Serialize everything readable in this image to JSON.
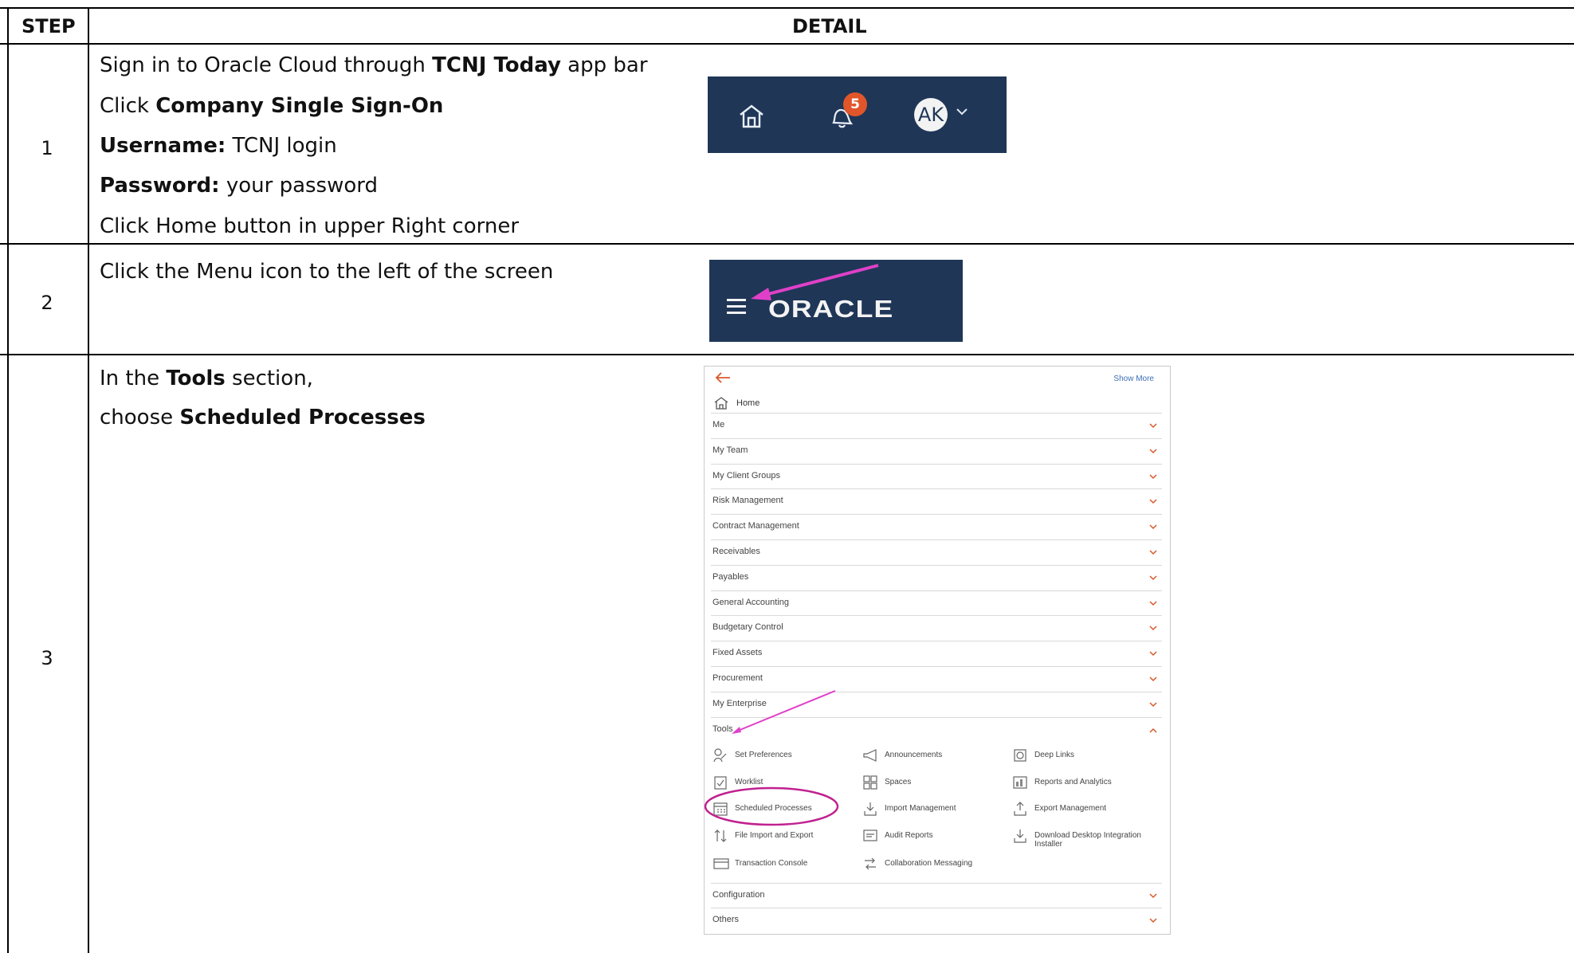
{
  "table": {
    "header_step": "STEP",
    "header_detail": "DETAIL"
  },
  "steps": [
    {
      "number": "1",
      "lines": [
        {
          "pre": "Sign in to Oracle Cloud through ",
          "bold": "TCNJ Today",
          "post": " app bar"
        },
        {
          "pre": "Click ",
          "bold": "Company Single Sign-On",
          "post": ""
        },
        {
          "pre": "",
          "bold": "Username:",
          "post": " TCNJ login"
        },
        {
          "pre": "",
          "bold": "Password:",
          "post": " your password"
        },
        {
          "pre": "Click Home button in upper Right corner",
          "bold": "",
          "post": ""
        }
      ],
      "appbar": {
        "notification_count": "5",
        "avatar_initials": "AK",
        "bg_color": "#1f3657",
        "badge_color": "#e0562a"
      }
    },
    {
      "number": "2",
      "lines": [
        {
          "pre": "Click the Menu icon to the left of the screen",
          "bold": "",
          "post": ""
        }
      ],
      "oraclebar": {
        "logo_text": "ORACLE",
        "arrow_color": "#e040c8"
      }
    },
    {
      "number": "3",
      "lines": [
        {
          "pre": "In the ",
          "bold": "Tools",
          "post": " section,"
        },
        {
          "pre": "choose ",
          "bold": "Scheduled Processes",
          "post": ""
        }
      ],
      "navigator": {
        "show_more": "Show More",
        "home": "Home",
        "sections": [
          "Me",
          "My Team",
          "My Client Groups",
          "Risk Management",
          "Contract Management",
          "Receivables",
          "Payables",
          "General Accounting",
          "Budgetary Control",
          "Fixed Assets",
          "Procurement",
          "My Enterprise"
        ],
        "tools_label": "Tools",
        "tools": [
          [
            "Set Preferences",
            "Announcements",
            "Deep Links"
          ],
          [
            "Worklist",
            "Spaces",
            "Reports and Analytics"
          ],
          [
            "Scheduled Processes",
            "Import Management",
            "Export Management"
          ],
          [
            "File Import and Export",
            "Audit Reports",
            "Download Desktop Integration Installer"
          ],
          [
            "Transaction Console",
            "Collaboration Messaging",
            ""
          ]
        ],
        "bottom_sections": [
          "Configuration",
          "Others"
        ],
        "highlight_color": "#c0218f"
      }
    }
  ]
}
